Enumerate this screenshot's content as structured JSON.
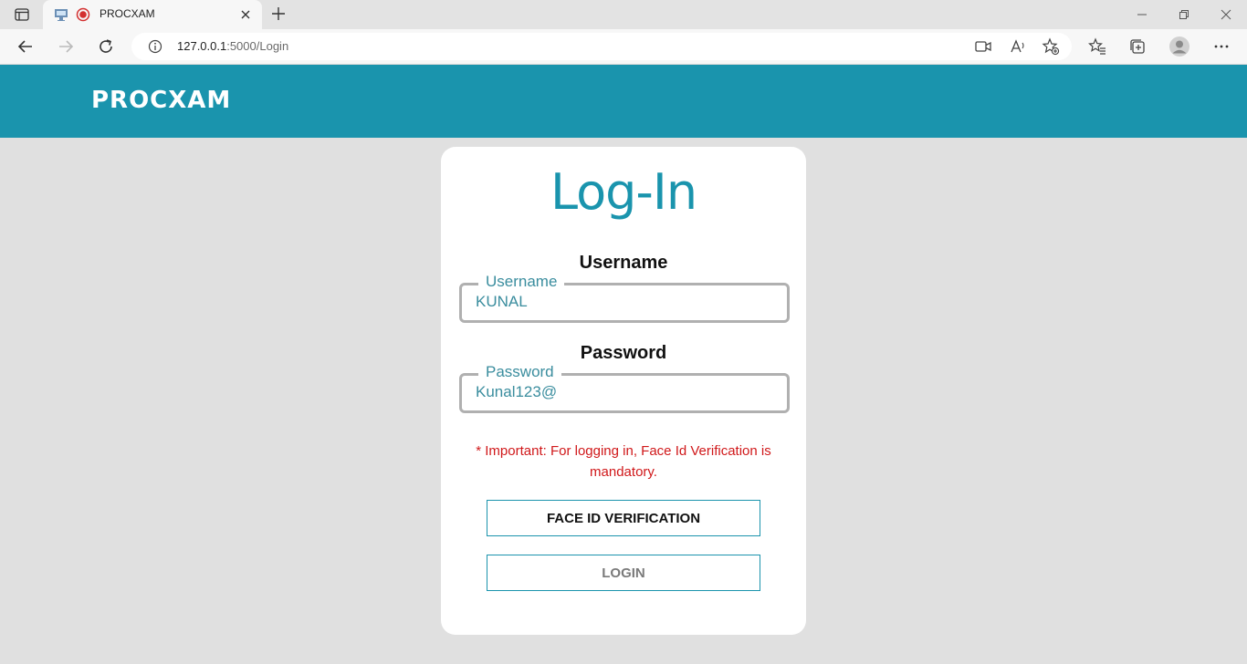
{
  "browser": {
    "tab_title": "PROCXAM",
    "url_host": "127.0.0.1",
    "url_path": ":5000/Login"
  },
  "header": {
    "brand": "PROCXAM"
  },
  "login": {
    "heading": "Log-In",
    "username_label": "Username",
    "username_legend": "Username",
    "username_value": "KUNAL",
    "password_label": "Password",
    "password_legend": "Password",
    "password_value": "Kunal123@",
    "note": "* Important: For logging in, Face Id Verification is mandatory.",
    "face_button": "FACE ID VERIFICATION",
    "login_button": "LOGIN"
  },
  "colors": {
    "accent": "#1a94ad",
    "background": "#e0e0e0",
    "warning": "#d0181a"
  }
}
